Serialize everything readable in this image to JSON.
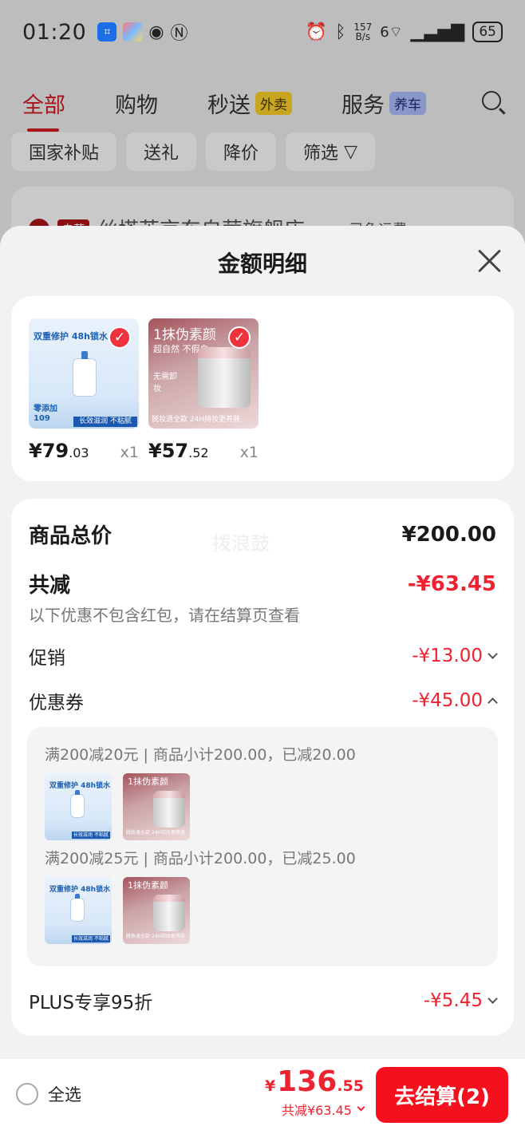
{
  "status_bar": {
    "time": "01:20",
    "net_speed_value": "157",
    "net_speed_unit": "B/s",
    "wifi_label": "6",
    "battery": "65"
  },
  "background_page": {
    "tabs": [
      {
        "label": "全部",
        "active": true
      },
      {
        "label": "购物"
      },
      {
        "label": "秒送",
        "badge": "外卖"
      },
      {
        "label": "服务",
        "badge": "养车"
      }
    ],
    "chips": [
      "国家补贴",
      "送礼",
      "降价",
      "筛选"
    ],
    "shop_name": "丝塔芙京东自营旗舰店",
    "shop_right": "已免运费"
  },
  "sheet": {
    "title": "金额明细",
    "products": [
      {
        "price_int": "¥79",
        "price_dec": ".03",
        "qty": "x1",
        "img_text": {
          "l1": "双重修护 48h锁水",
          "l2": "零添加",
          "l3": "109",
          "bar": "长效滋润 不粘腻"
        }
      },
      {
        "price_int": "¥57",
        "price_dec": ".52",
        "qty": "x1",
        "img_text": {
          "l1": "1抹伪素颜",
          "l2": "超自然 不假白",
          "l3": "无需卸妆",
          "bar": "脱妆退全款 24H持妆更养肤"
        }
      }
    ],
    "watermark": "拨浪鼓",
    "total_label": "商品总价",
    "total_value": "¥200.00",
    "discount_label": "共减",
    "discount_value": "-¥63.45",
    "discount_note": "以下优惠不包含红包，请在结算页查看",
    "promo_label": "促销",
    "promo_value": "-¥13.00",
    "coupon_label": "优惠券",
    "coupon_value": "-¥45.00",
    "coupons": [
      {
        "text": "满200减20元 | 商品小计200.00，已减20.00"
      },
      {
        "text": "满200减25元 | 商品小计200.00，已减25.00"
      }
    ],
    "plus_label": "PLUS专享95折",
    "plus_value": "-¥5.45"
  },
  "bottom_bar": {
    "select_all": "全选",
    "total_yen": "¥",
    "total_int": "136",
    "total_dec": ".55",
    "total_sub": "共减¥63.45",
    "checkout": "去结算(2)"
  },
  "colors": {
    "accent": "#ee2230",
    "checkout_bg": "#f5101e",
    "dim_bg": "#bdbdbd",
    "sheet_bg": "#f2f2f2"
  }
}
